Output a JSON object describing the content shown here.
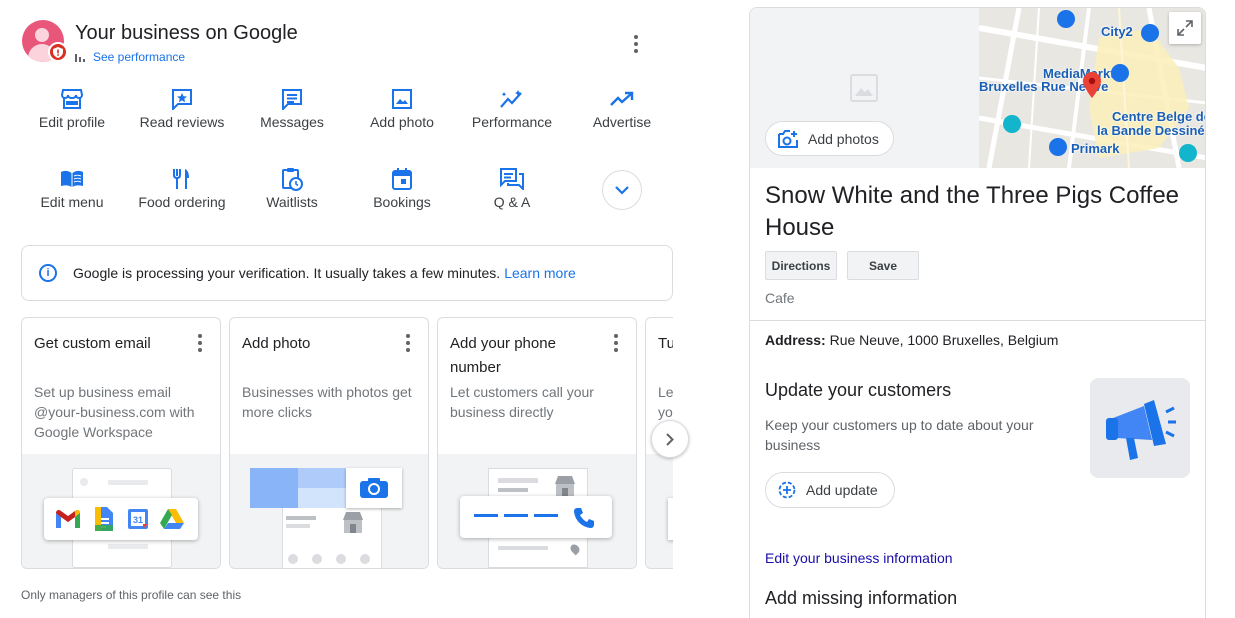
{
  "header": {
    "title": "Your business on Google",
    "see_performance": "See performance"
  },
  "actions": [
    {
      "label": "Edit profile",
      "icon": "storefront-icon"
    },
    {
      "label": "Read reviews",
      "icon": "star-review-icon"
    },
    {
      "label": "Messages",
      "icon": "message-icon"
    },
    {
      "label": "Add photo",
      "icon": "image-icon"
    },
    {
      "label": "Performance",
      "icon": "sparkline-icon"
    },
    {
      "label": "Advertise",
      "icon": "trending-up-icon"
    },
    {
      "label": "Edit menu",
      "icon": "menu-book-icon"
    },
    {
      "label": "Food ordering",
      "icon": "fork-knife-icon"
    },
    {
      "label": "Waitlists",
      "icon": "clipboard-clock-icon"
    },
    {
      "label": "Bookings",
      "icon": "calendar-icon"
    },
    {
      "label": "Q & A",
      "icon": "forum-icon"
    }
  ],
  "verification": {
    "text": "Google is processing your verification. It usually takes a few minutes.",
    "link": "Learn more"
  },
  "cards": [
    {
      "title": "Get custom email",
      "description": "Set up business email @your-business.com with Google Workspace"
    },
    {
      "title": "Add photo",
      "description": "Businesses with photos get more clicks"
    },
    {
      "title": "Add your phone number",
      "description": "Let customers call your business directly"
    },
    {
      "title": "Tu",
      "description": "Le yo"
    }
  ],
  "managers_note": "Only managers of this profile can see this",
  "profile": {
    "add_photos": "Add photos",
    "map_labels": [
      "City2",
      "MediaMarkt",
      "Bruxelles Rue Neuve",
      "Centre Belge de",
      "la Bande Dessiné",
      "Primark"
    ],
    "name": "Snow White and the Three Pigs Coffee House",
    "directions": "Directions",
    "save": "Save",
    "category": "Cafe",
    "address_label": "Address:",
    "address_value": "Rue Neuve, 1000 Bruxelles, Belgium",
    "update_title": "Update your customers",
    "update_desc": "Keep your customers up to date about your business",
    "add_update": "Add update",
    "edit_info": "Edit your business information",
    "missing_title": "Add missing information"
  },
  "colors": {
    "accent": "#1a73e8",
    "avatar": "#e8577a",
    "badge": "#d93025",
    "map_pin": "#ea4335"
  }
}
